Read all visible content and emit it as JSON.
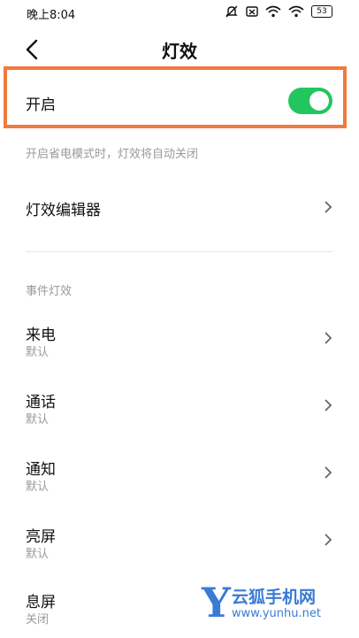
{
  "status_bar": {
    "time": "晚上8:04",
    "battery": "53"
  },
  "header": {
    "title": "灯效"
  },
  "main_toggle": {
    "label": "开启",
    "enabled": true,
    "accent": "#22c55e",
    "highlight_color": "#f07a3c"
  },
  "hint": "开启省电模式时，灯效将自动关闭",
  "editor": {
    "label": "灯效编辑器"
  },
  "section_title": "事件灯效",
  "events": [
    {
      "label": "来电",
      "value": "默认"
    },
    {
      "label": "通话",
      "value": "默认"
    },
    {
      "label": "通知",
      "value": "默认"
    },
    {
      "label": "亮屏",
      "value": "默认"
    },
    {
      "label": "息屏",
      "value": "关闭"
    }
  ],
  "watermark": {
    "brand": "云狐手机网",
    "url": "www.yunhu.net",
    "color": "#3a7bd5"
  }
}
